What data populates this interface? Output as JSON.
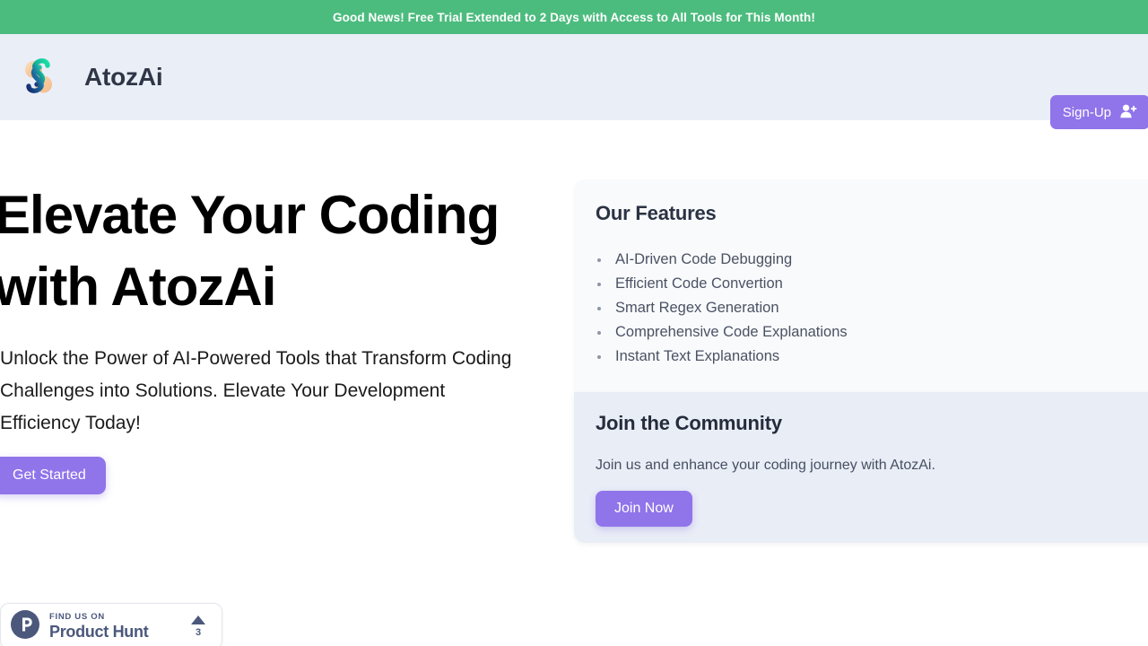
{
  "banner": {
    "message": "Good News! Free Trial Extended to 2 Days with Access to All Tools for This Month!",
    "background_color": "#4cbc7e"
  },
  "header": {
    "brand_name": "AtozAi",
    "logo_icon": "atozai-swirl-logo",
    "background_color": "#eaeef7",
    "signup": {
      "label": "Sign-Up",
      "icon": "person-add-icon",
      "color": "#9074ea"
    }
  },
  "hero": {
    "title": "Elevate Your Coding with AtozAi",
    "subtitle": "Unlock the Power of AI-Powered Tools that Transform Coding Challenges into Solutions. Elevate Your Development Efficiency Today!",
    "cta_label": "Get Started",
    "cta_color": "#9074ea"
  },
  "features_card": {
    "title": "Our Features",
    "items": [
      "AI-Driven Code Debugging",
      "Efficient Code Convertion",
      "Smart Regex Generation",
      "Comprehensive Code Explanations",
      "Instant Text Explanations"
    ],
    "background_color": "#f8fafc"
  },
  "community_card": {
    "title": "Join the Community",
    "description": "Join us and enhance your coding journey with AtozAi.",
    "cta_label": "Join Now",
    "background_color": "#e9edf6"
  },
  "product_hunt_badge": {
    "kicker": "FIND US ON",
    "name": "Product Hunt",
    "upvote_count": "3",
    "logo_icon": "product-hunt-p-icon",
    "arrow_icon": "upvote-triangle-icon",
    "color": "#4b587c"
  }
}
